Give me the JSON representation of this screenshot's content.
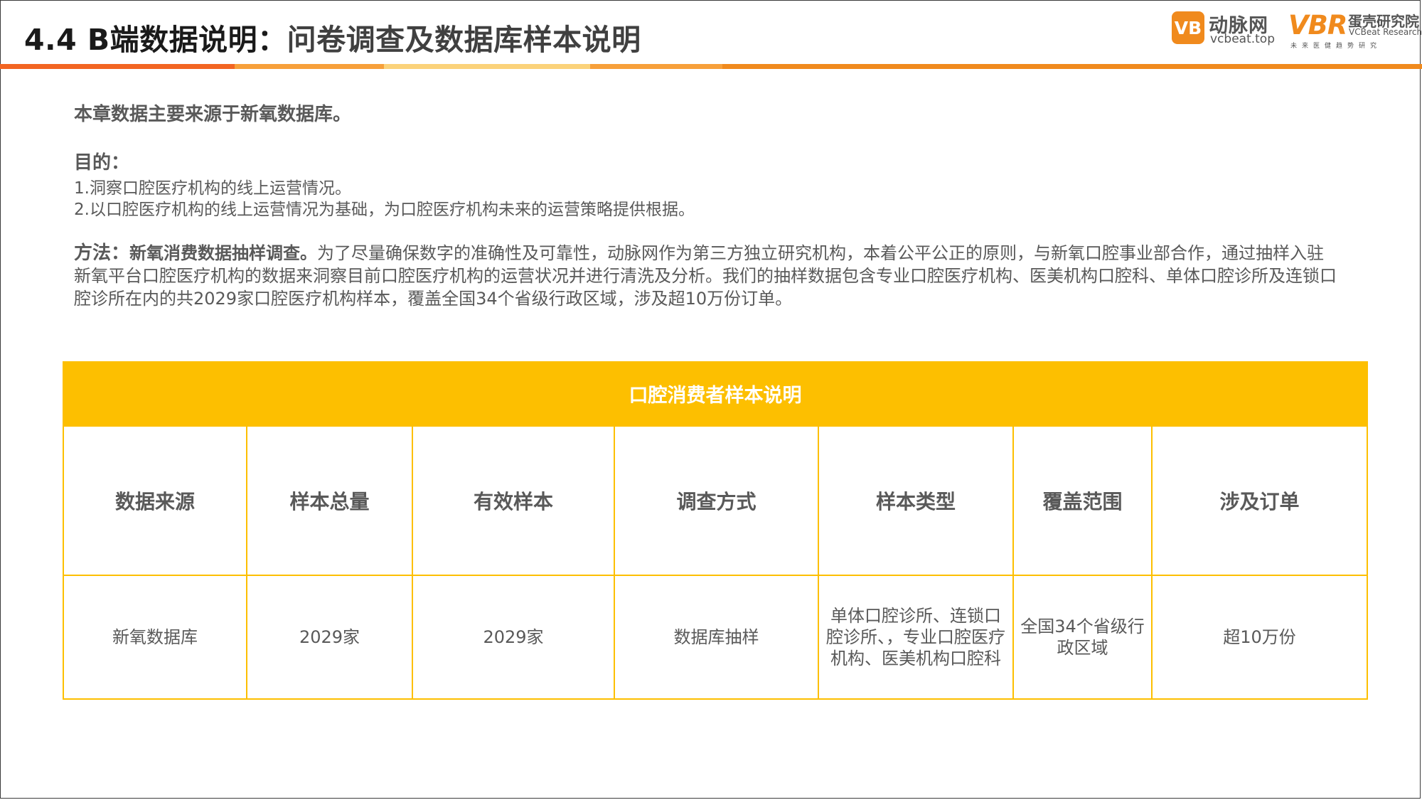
{
  "header": {
    "title_prefix": "4.4 B端数据说明：",
    "title_rest": "问卷调查及数据库样本说明",
    "bar_colors": [
      "#f26522",
      "#f7a03a",
      "#fbd27a",
      "#f7a03a",
      "#f08a1d"
    ]
  },
  "logos": {
    "vcbeat_badge": "VB",
    "vcbeat_cn": "动脉网",
    "vcbeat_en": "vcbeat.top",
    "vbr_mark": "VBR",
    "vbr_cn": "蛋壳研究院",
    "vbr_en": "VCBeat Research",
    "vbr_sub": "未来医健趋势研究"
  },
  "body": {
    "intro": "本章数据主要来源于新氧数据库。",
    "purpose_heading": "目的：",
    "purpose_items": [
      "1.洞察口腔医疗机构的线上运营情况。",
      "2.以口腔医疗机构的线上运营情况为基础，为口腔医疗机构未来的运营策略提供根据。"
    ],
    "method_heading": "方法：",
    "method_bold": "新氧消费数据抽样调查。",
    "method_text": "为了尽量确保数字的准确性及可靠性，动脉网作为第三方独立研究机构，本着公平公正的原则，与新氧口腔事业部合作，通过抽样入驻新氧平台口腔医疗机构的数据来洞察目前口腔医疗机构的运营状况并进行清洗及分析。我们的抽样数据包含专业口腔医疗机构、医美机构口腔科、单体口腔诊所及连锁口腔诊所在内的共2029家口腔医疗机构样本，覆盖全国34个省级行政区域，涉及超10万份订单。"
  },
  "table": {
    "title": "口腔消费者样本说明",
    "border_color": "#fdbf00",
    "headers": [
      "数据来源",
      "样本总量",
      "有效样本",
      "调查方式",
      "样本类型",
      "覆盖范围",
      "涉及订单"
    ],
    "row": [
      "新氧数据库",
      "2029家",
      "2029家",
      "数据库抽样",
      "单体口腔诊所、连锁口腔诊所、，专业口腔医疗机构、医美机构口腔科",
      "全国34个省级行政区域",
      "超10万份"
    ]
  }
}
